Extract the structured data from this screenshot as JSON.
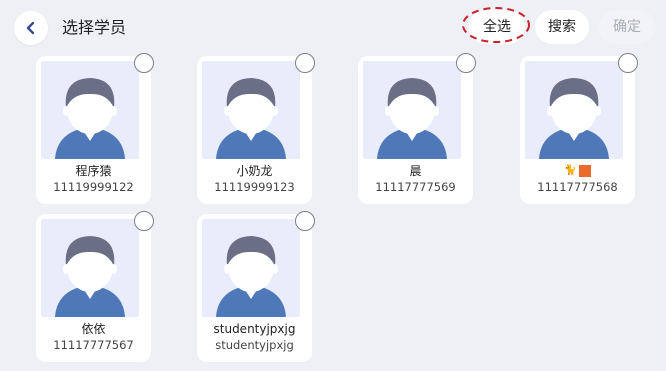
{
  "header": {
    "title": "选择学员",
    "select_all": "全选",
    "search": "搜索",
    "confirm": "确定"
  },
  "students": [
    {
      "name": "程序猿",
      "account": "11119999122"
    },
    {
      "name": "小奶龙",
      "account": "11119999123"
    },
    {
      "name": "晨",
      "account": "11117777569"
    },
    {
      "name": "",
      "account": "11117777568",
      "name_icons": [
        "cat-emoji-icon",
        "orange-square-icon"
      ]
    },
    {
      "name": "依依",
      "account": "11117777567"
    },
    {
      "name": "studentyjpxjg",
      "account": "studentyjpxjg"
    }
  ],
  "colors": {
    "background": "#eef0f5",
    "avatar_bg": "#e9edfb",
    "avatar_hair": "#6a6f86",
    "avatar_shirt": "#4f78b8",
    "highlight": "#c8232c"
  }
}
